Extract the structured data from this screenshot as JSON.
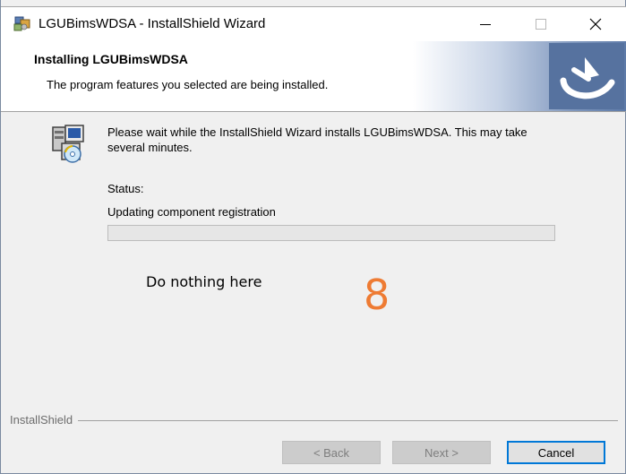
{
  "window": {
    "title": "LGUBimsWDSA - InstallShield Wizard",
    "minimize_icon": "minimize-icon",
    "maximize_icon": "maximize-icon",
    "close_icon": "close-icon"
  },
  "banner": {
    "title": "Installing LGUBimsWDSA",
    "subtitle": "The program features you selected are being installed.",
    "logo_icon": "installshield-logo-icon"
  },
  "body": {
    "icon": "setup-computer-icon",
    "message": "Please wait while the InstallShield Wizard installs LGUBimsWDSA. This may take several minutes.",
    "status_label": "Status:",
    "status_value": "Updating component registration",
    "progress_fraction": 0.0
  },
  "annotation": {
    "hint": "Do nothing here",
    "number": "8"
  },
  "footer": {
    "brand": "InstallShield",
    "back_label": "< Back",
    "next_label": "Next >",
    "cancel_label": "Cancel"
  },
  "colors": {
    "accent": "#0078d7",
    "annotation_number": "#ee7b33",
    "progress": "#06b025"
  }
}
